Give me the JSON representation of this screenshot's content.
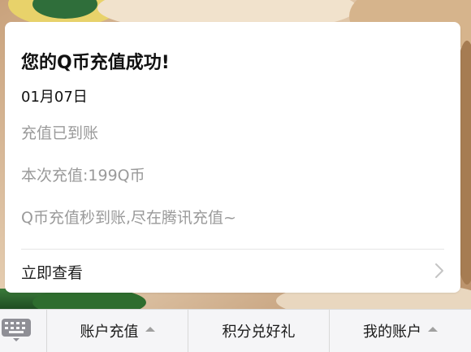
{
  "card": {
    "title": "您的Q币充值成功!",
    "date": "01月07日",
    "status": "充值已到账",
    "amount": "本次充值:199Q币",
    "promo": "Q币充值秒到账,尽在腾讯充值~",
    "action_label": "立即查看",
    "action_icon": "chevron-right-icon"
  },
  "bottom_menu": {
    "keyboard_icon": "keyboard-icon",
    "items": [
      {
        "label": "账户充值",
        "has_submenu": true
      },
      {
        "label": "积分兑好礼",
        "has_submenu": false
      },
      {
        "label": "我的账户",
        "has_submenu": true
      }
    ]
  }
}
